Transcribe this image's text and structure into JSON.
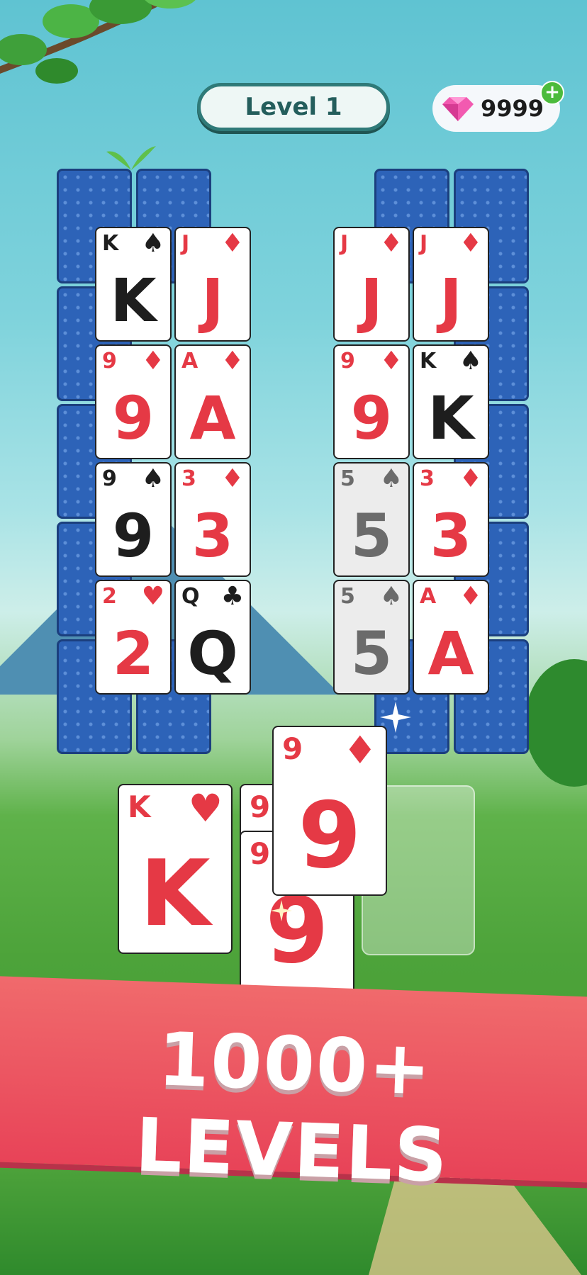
{
  "header": {
    "level_label": "Level 1",
    "gems": "9999",
    "plus": "+"
  },
  "left_tableau": [
    {
      "rank": "K",
      "suit": "♠",
      "color": "blk"
    },
    {
      "rank": "J",
      "suit": "♦",
      "color": "red"
    },
    {
      "rank": "9",
      "suit": "♦",
      "color": "red"
    },
    {
      "rank": "A",
      "suit": "♦",
      "color": "red"
    },
    {
      "rank": "9",
      "suit": "♠",
      "color": "blk"
    },
    {
      "rank": "3",
      "suit": "♦",
      "color": "red"
    },
    {
      "rank": "2",
      "suit": "♥",
      "color": "red"
    },
    {
      "rank": "Q",
      "suit": "♣",
      "color": "blk"
    }
  ],
  "right_tableau": [
    {
      "rank": "J",
      "suit": "♦",
      "color": "red"
    },
    {
      "rank": "J",
      "suit": "♦",
      "color": "red"
    },
    {
      "rank": "9",
      "suit": "♦",
      "color": "red"
    },
    {
      "rank": "K",
      "suit": "♠",
      "color": "blk"
    },
    {
      "rank": "5",
      "suit": "♠",
      "color": "gry"
    },
    {
      "rank": "3",
      "suit": "♦",
      "color": "red"
    },
    {
      "rank": "5",
      "suit": "♠",
      "color": "gry"
    },
    {
      "rank": "A",
      "suit": "♦",
      "color": "red"
    }
  ],
  "hand": {
    "k_heart": {
      "rank": "K",
      "suit": "♥"
    },
    "nine_back": {
      "rank": "9"
    },
    "nine_mid": {
      "rank": "9",
      "big": "9"
    },
    "nine_top": {
      "rank": "9",
      "suit": "♦"
    }
  },
  "banner": {
    "text": "1000+ LEVELS"
  },
  "colors": {
    "red": "#e53945",
    "black": "#1e1e1e",
    "banner": "#e84358",
    "card_back": "#2d63b8"
  }
}
